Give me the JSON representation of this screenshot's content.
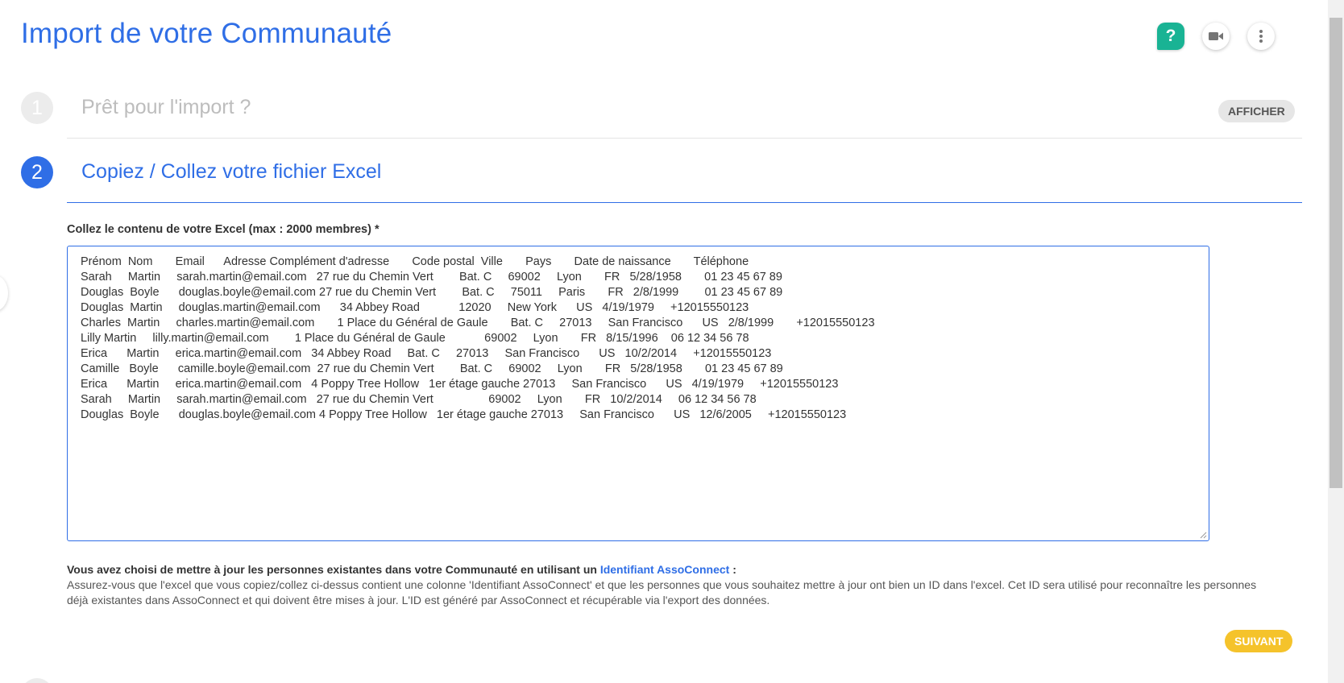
{
  "header": {
    "title": "Import de votre Communauté",
    "help_label": "?",
    "icons": [
      "help-icon",
      "video-camera-icon",
      "more-vertical-icon"
    ]
  },
  "steps": {
    "step1": {
      "number": "1",
      "title": "Prêt pour l'import ?",
      "action_label": "AFFICHER"
    },
    "step2": {
      "number": "2",
      "title": "Copiez / Collez votre fichier Excel",
      "field_label": "Collez le contenu de votre Excel (max : 2000 membres) *",
      "pasted_lines": [
        "Prénom  Nom       Email      Adresse Complément d'adresse       Code postal  Ville       Pays       Date de naissance       Téléphone",
        "Sarah     Martin     sarah.martin@email.com   27 rue du Chemin Vert        Bat. C     69002     Lyon       FR   5/28/1958       01 23 45 67 89",
        "Douglas  Boyle      douglas.boyle@email.com 27 rue du Chemin Vert        Bat. C     75011     Paris       FR   2/8/1999        01 23 45 67 89",
        "Douglas  Martin     douglas.martin@email.com      34 Abbey Road            12020     New York      US   4/19/1979     +12015550123",
        "Charles  Martin     charles.martin@email.com       1 Place du Général de Gaule       Bat. C     27013     San Francisco      US   2/8/1999       +12015550123",
        "Lilly Martin     lilly.martin@email.com        1 Place du Général de Gaule            69002     Lyon       FR   8/15/1996    06 12 34 56 78",
        "Erica      Martin     erica.martin@email.com   34 Abbey Road     Bat. C     27013     San Francisco      US   10/2/2014     +12015550123",
        "Camille   Boyle      camille.boyle@email.com  27 rue du Chemin Vert        Bat. C     69002     Lyon       FR   5/28/1958       01 23 45 67 89",
        "Erica      Martin     erica.martin@email.com   4 Poppy Tree Hollow   1er étage gauche 27013     San Francisco      US   4/19/1979     +12015550123",
        "Sarah     Martin     sarah.martin@email.com   27 rue du Chemin Vert                 69002     Lyon       FR   10/2/2014     06 12 34 56 78",
        "Douglas  Boyle      douglas.boyle@email.com 4 Poppy Tree Hollow   1er étage gauche 27013     San Francisco      US   12/6/2005     +12015550123"
      ],
      "info_intro": "Vous avez choisi de mettre à jour les personnes existantes dans votre Communauté en utilisant un ",
      "info_link": "Identifiant AssoConnect",
      "info_colon": " :",
      "info_text": "Assurez-vous que l'excel que vous copiez/collez ci-dessus contient une colonne 'Identifiant AssoConnect' et que les personnes que vous souhaitez mettre à jour ont bien un ID dans l'excel. Cet ID sera utilisé pour reconnaître les personnes déjà existantes dans AssoConnect et qui doivent être mises à jour. L'ID est généré par AssoConnect et récupérable via l'export des données.",
      "next_label": "SUIVANT"
    }
  },
  "colors": {
    "accent": "#2f6ee6",
    "help": "#19b394",
    "next": "#f5c32b"
  }
}
